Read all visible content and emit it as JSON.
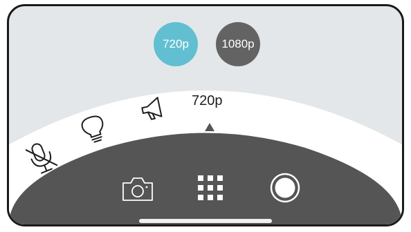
{
  "resolution_options": [
    {
      "label": "720p",
      "selected": true,
      "color": "#62bfd1"
    },
    {
      "label": "1080p",
      "selected": false,
      "color": "#636363"
    }
  ],
  "dial": {
    "current_label": "720p",
    "items": [
      {
        "icon": "microphone-muted-icon"
      },
      {
        "icon": "lightbulb-icon"
      },
      {
        "icon": "megaphone-icon"
      }
    ]
  },
  "toolbar": {
    "items": [
      {
        "icon": "camera-icon"
      },
      {
        "icon": "grid-icon"
      },
      {
        "icon": "record-icon"
      }
    ]
  },
  "colors": {
    "background": "#e4e7e9",
    "arc": "#ffffff",
    "tray": "#555555",
    "accent": "#62bfd1"
  }
}
